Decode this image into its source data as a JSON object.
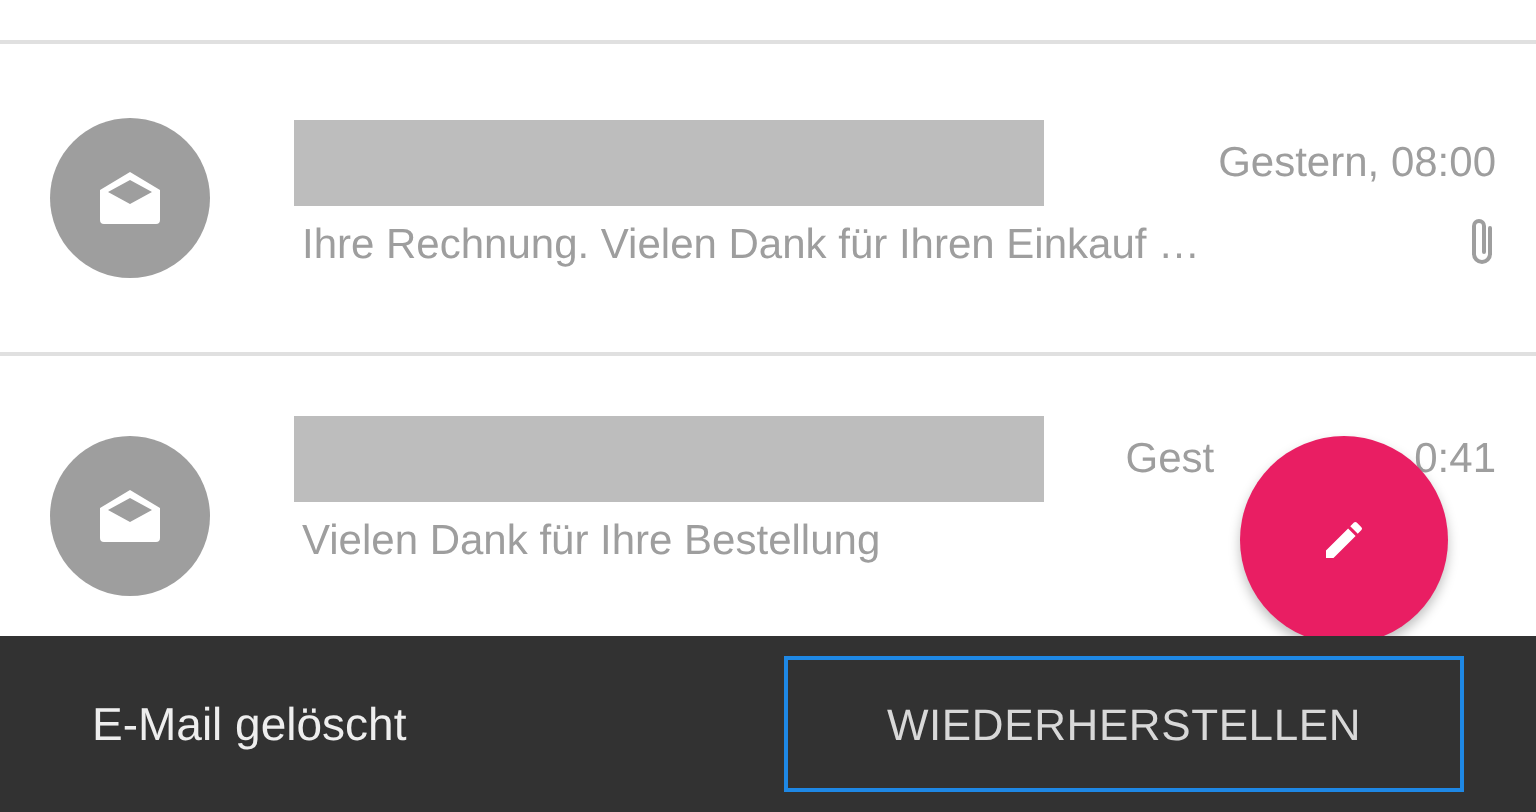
{
  "messages": [
    {
      "subject_redacted": true,
      "time_parts": [
        "Gestern, 08:00"
      ],
      "preview": "Ihre Rechnung. Vielen Dank für Ihren Einkauf …",
      "attachment": true
    },
    {
      "subject_redacted": true,
      "time_parts": [
        "Gest",
        "0:41"
      ],
      "preview": "Vielen Dank für Ihre Bestellung",
      "attachment": false
    }
  ],
  "snackbar": {
    "message": "E-Mail gelöscht",
    "action": "WIEDERHERSTELLEN"
  }
}
